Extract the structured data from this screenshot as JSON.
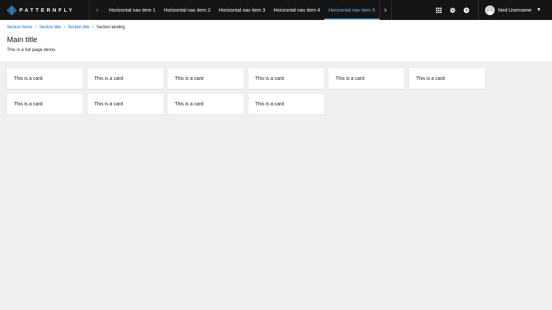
{
  "brand": {
    "name": "PATTERNFLY"
  },
  "nav": {
    "prev_icon": "chevron-left-icon",
    "next_icon": "chevron-right-icon",
    "items": [
      {
        "label": "Horizontal nav item 1",
        "active": false
      },
      {
        "label": "Horizontal nav item 2",
        "active": false
      },
      {
        "label": "Horizontal nav item 3",
        "active": false
      },
      {
        "label": "Horizontal nav item 4",
        "active": false
      },
      {
        "label": "Horizontal nav item 5",
        "active": true
      }
    ]
  },
  "tools": [
    "app-launcher-icon",
    "settings-icon",
    "help-icon"
  ],
  "user": {
    "name": "Ned Username"
  },
  "breadcrumb": [
    "Section home",
    "Section title",
    "Section title",
    "Section landing"
  ],
  "page": {
    "title": "Main title",
    "subtitle": "This is a full page demo."
  },
  "cards": [
    "This is a card",
    "This is a card",
    "This is a card",
    "This is a card",
    "This is a card",
    "This is a card",
    "This is a card",
    "This is a card",
    "This is a card",
    "This is a card"
  ],
  "colors": {
    "masthead_bg": "#151515",
    "active_nav": "#73bcf7",
    "link": "#0066cc",
    "page_bg": "#f0f0f0"
  }
}
